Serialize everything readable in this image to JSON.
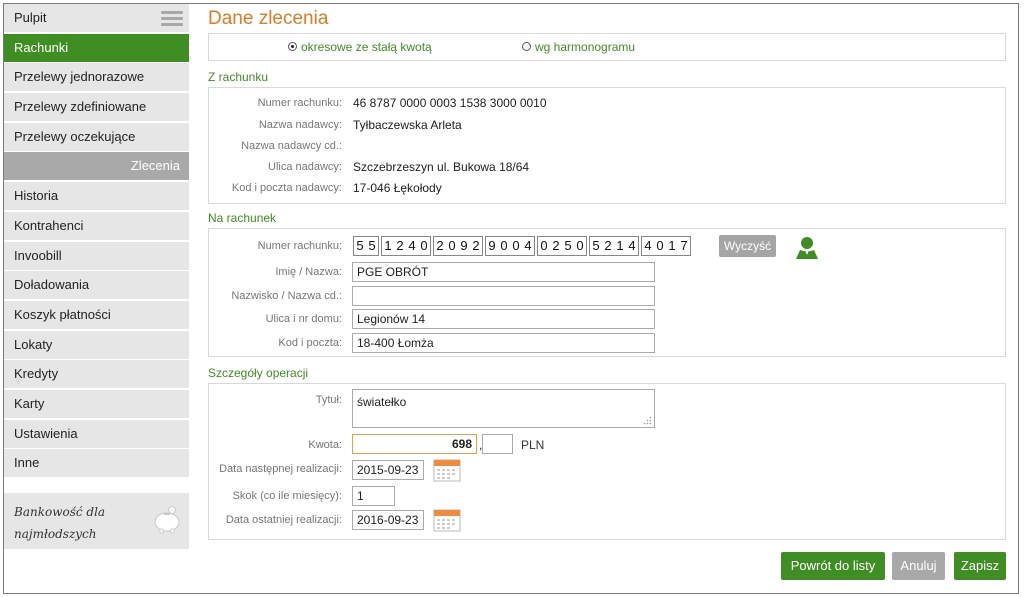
{
  "sidebar": {
    "items": [
      {
        "label": "Pulpit"
      },
      {
        "label": "Rachunki"
      },
      {
        "label": "Przelewy jednorazowe"
      },
      {
        "label": "Przelewy zdefiniowane"
      },
      {
        "label": "Przelewy oczekujące"
      },
      {
        "label": "Zlecenia"
      },
      {
        "label": "Historia"
      },
      {
        "label": "Kontrahenci"
      },
      {
        "label": "Invoobill"
      },
      {
        "label": "Doładowania"
      },
      {
        "label": "Koszyk płatności"
      },
      {
        "label": "Lokaty"
      },
      {
        "label": "Kredyty"
      },
      {
        "label": "Karty"
      },
      {
        "label": "Ustawienia"
      },
      {
        "label": "Inne"
      }
    ],
    "promo": "Bankowość dla najmłodszych"
  },
  "page": {
    "title": "Dane zlecenia",
    "radio_fixed": "okresowe ze stałą kwotą",
    "radio_schedule": "wg harmonogramu"
  },
  "from_account": {
    "section_title": "Z rachunku",
    "rows": [
      {
        "label": "Numer rachunku:",
        "value": "46 8787 0000 0003 1538 3000 0010"
      },
      {
        "label": "Nazwa nadawcy:",
        "value": "Tyłbaczewska Arleta"
      },
      {
        "label": "Nazwa nadawcy cd.:",
        "value": ""
      },
      {
        "label": "Ulica nadawcy:",
        "value": "Szczebrzeszyn ul. Bukowa 18/64"
      },
      {
        "label": "Kod i poczta nadawcy:",
        "value": "17-046 Łękołody"
      }
    ]
  },
  "to_account": {
    "section_title": "Na rachunek",
    "account_label": "Numer rachunku:",
    "account_groups": [
      [
        "5",
        "5"
      ],
      [
        "1",
        "2",
        "4",
        "0"
      ],
      [
        "2",
        "0",
        "9",
        "2"
      ],
      [
        "9",
        "0",
        "0",
        "4"
      ],
      [
        "0",
        "2",
        "5",
        "0"
      ],
      [
        "5",
        "2",
        "1",
        "4"
      ],
      [
        "4",
        "0",
        "1",
        "7"
      ]
    ],
    "clear_button": "Wyczyść",
    "name_label": "Imię / Nazwa:",
    "name_value": "PGE OBRÓT",
    "surname_label": "Nazwisko / Nazwa cd.:",
    "surname_value": "",
    "street_label": "Ulica i nr domu:",
    "street_value": "Legionów 14",
    "postal_label": "Kod i poczta:",
    "postal_value": "18-400 Łomża"
  },
  "details": {
    "section_title": "Szczegóły operacji",
    "title_label": "Tytuł:",
    "title_value": "światełko",
    "amount_label": "Kwota:",
    "amount_int": "698",
    "amount_sep": ",",
    "amount_dec": "",
    "currency": "PLN",
    "next_date_label": "Data następnej realizacji:",
    "next_date_value": "2015-09-23",
    "step_label": "Skok (co ile miesięcy):",
    "step_value": "1",
    "last_date_label": "Data ostatniej realizacji:",
    "last_date_value": "2016-09-23"
  },
  "actions": {
    "back": "Powrót do listy",
    "cancel": "Anuluj",
    "save": "Zapisz"
  },
  "colors": {
    "accent_green": "#3f8e24",
    "title_orange": "#e07b24",
    "section_grey": "#a9a9a9"
  }
}
